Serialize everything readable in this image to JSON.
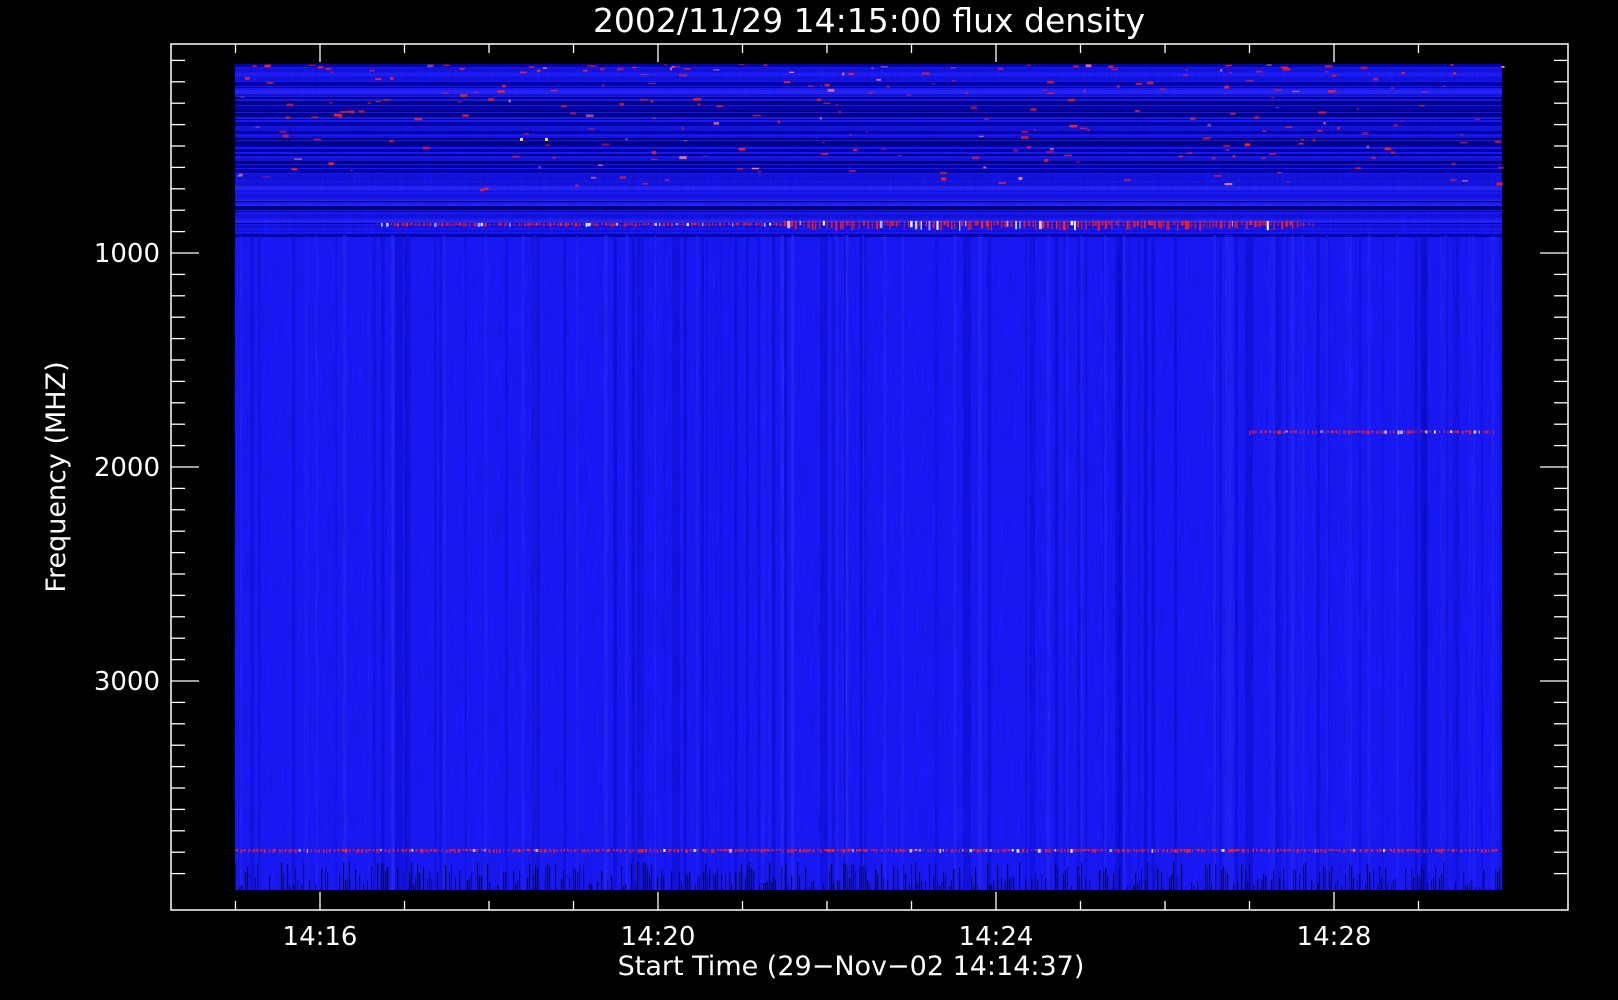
{
  "chart_data": {
    "type": "heatmap",
    "title": "2002/11/29 14:15:00 flux density",
    "xlabel": "Start Time (29−Nov−02 14:14:37)",
    "ylabel": "Frequency (MHZ)",
    "x_start": "14:14:37",
    "x_tick_labels": [
      "14:16",
      "14:20",
      "14:24",
      "14:28"
    ],
    "y_tick_labels": [
      "1000",
      "2000",
      "3000"
    ],
    "y_tick_values": [
      1000,
      2000,
      3000
    ],
    "y_reversed": true,
    "colormap": {
      "background": "#1a1aff",
      "low": "#0000b0",
      "high": "#ff1a1a"
    },
    "features": [
      {
        "kind": "horizontal-band",
        "frequency_mhz": 920,
        "time_range": [
          "14:16:40",
          "14:27:45"
        ],
        "color": "#ff2020"
      },
      {
        "kind": "horizontal-band",
        "frequency_mhz": 1890,
        "time_range": [
          "14:27:00",
          "14:29:55"
        ],
        "color": "#ff2020"
      },
      {
        "kind": "horizontal-band",
        "frequency_mhz": 3820,
        "time_range": [
          "14:15:00",
          "14:29:55"
        ],
        "color": "#ff2020"
      },
      {
        "kind": "noise-band",
        "frequency_range_mhz": [
          100,
          700
        ],
        "color": "#ff2020"
      },
      {
        "kind": "noise-band",
        "frequency_range_mhz": [
          3820,
          3990
        ],
        "color": "#000040"
      }
    ]
  }
}
